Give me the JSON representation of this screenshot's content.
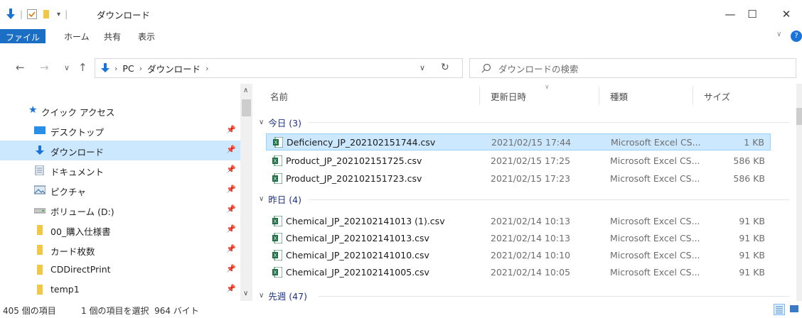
{
  "window": {
    "title": "ダウンロード",
    "minimize": "—",
    "maximize": "☐",
    "close": "✕"
  },
  "ribbon": {
    "tabs": [
      "ファイル",
      "ホーム",
      "共有",
      "表示"
    ]
  },
  "address": {
    "crumbs": [
      "PC",
      "ダウンロード"
    ],
    "search_placeholder": "ダウンロードの検索"
  },
  "nav": {
    "items": [
      {
        "label": "クイック アクセス",
        "icon": "star-icon",
        "pinned": false
      },
      {
        "label": "デスクトップ",
        "icon": "desktop-icon",
        "pinned": true
      },
      {
        "label": "ダウンロード",
        "icon": "download-icon",
        "pinned": true,
        "selected": true
      },
      {
        "label": "ドキュメント",
        "icon": "document-icon",
        "pinned": true
      },
      {
        "label": "ピクチャ",
        "icon": "pictures-icon",
        "pinned": true
      },
      {
        "label": "ボリューム (D:)",
        "icon": "drive-icon",
        "pinned": true
      },
      {
        "label": "00_購入仕様書",
        "icon": "folder-icon",
        "pinned": true
      },
      {
        "label": "カード枚数",
        "icon": "folder-icon",
        "pinned": true
      },
      {
        "label": "CDDirectPrint",
        "icon": "folder-icon",
        "pinned": true
      },
      {
        "label": "temp1",
        "icon": "folder-icon",
        "pinned": true
      }
    ]
  },
  "list": {
    "columns": {
      "name": "名前",
      "date": "更新日時",
      "type": "種類",
      "size": "サイズ"
    },
    "groups": [
      {
        "label": "今日 (3)",
        "files": [
          {
            "name": "Deficiency_JP_202102151744.csv",
            "date": "2021/02/15 17:44",
            "type": "Microsoft Excel CS...",
            "size": "1 KB",
            "selected": true
          },
          {
            "name": "Product_JP_202102151725.csv",
            "date": "2021/02/15 17:25",
            "type": "Microsoft Excel CS...",
            "size": "586 KB"
          },
          {
            "name": "Product_JP_202102151723.csv",
            "date": "2021/02/15 17:23",
            "type": "Microsoft Excel CS...",
            "size": "586 KB"
          }
        ]
      },
      {
        "label": "昨日 (4)",
        "files": [
          {
            "name": "Chemical_JP_202102141013 (1).csv",
            "date": "2021/02/14 10:13",
            "type": "Microsoft Excel CS...",
            "size": "91 KB"
          },
          {
            "name": "Chemical_JP_202102141013.csv",
            "date": "2021/02/14 10:13",
            "type": "Microsoft Excel CS...",
            "size": "91 KB"
          },
          {
            "name": "Chemical_JP_202102141010.csv",
            "date": "2021/02/14 10:10",
            "type": "Microsoft Excel CS...",
            "size": "91 KB"
          },
          {
            "name": "Chemical_JP_202102141005.csv",
            "date": "2021/02/14 10:05",
            "type": "Microsoft Excel CS...",
            "size": "91 KB"
          }
        ]
      },
      {
        "label": "先週 (47)",
        "files": []
      }
    ]
  },
  "status": {
    "item_count": "405 個の項目",
    "selection": "1 個の項目を選択  964 バイト"
  },
  "colors": {
    "accent": "#1a6fc4",
    "selection": "#cce8ff",
    "group_header": "#1e3287"
  }
}
